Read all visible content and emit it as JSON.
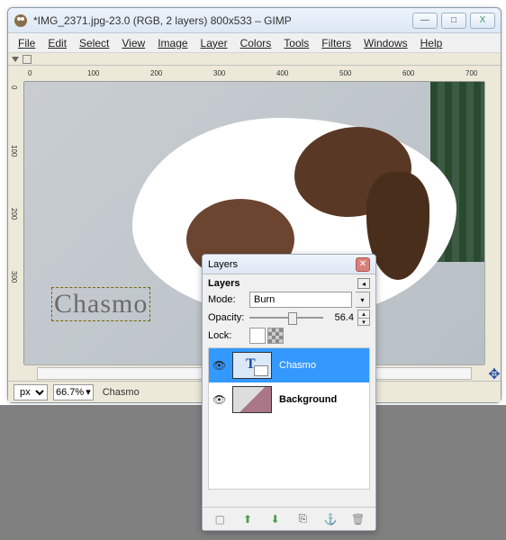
{
  "window": {
    "title": "*IMG_2371.jpg-23.0 (RGB, 2 layers) 800x533 – GIMP",
    "minimize": "—",
    "maximize": "□",
    "close": "X"
  },
  "menu": {
    "file": "File",
    "edit": "Edit",
    "select": "Select",
    "view": "View",
    "image": "Image",
    "layer": "Layer",
    "colors": "Colors",
    "tools": "Tools",
    "filters": "Filters",
    "windows": "Windows",
    "help": "Help"
  },
  "ruler_h": [
    "0",
    "100",
    "200",
    "300",
    "400",
    "500",
    "600",
    "700"
  ],
  "ruler_v": [
    "0",
    "100",
    "200",
    "300"
  ],
  "watermark_text": "Chasmo",
  "status": {
    "unit": "px",
    "zoom": "66.7%",
    "text": "Chasmo"
  },
  "layers_panel": {
    "title": "Layers",
    "section": "Layers",
    "mode_label": "Mode:",
    "mode_value": "Burn",
    "opacity_label": "Opacity:",
    "opacity_value": "56.4",
    "lock_label": "Lock:",
    "layers": [
      {
        "name": "Chasmo",
        "selected": true,
        "type": "text"
      },
      {
        "name": "Background",
        "selected": false,
        "type": "bg"
      }
    ],
    "footer_icons": {
      "new": "□",
      "up": "⬆",
      "down": "⬇",
      "duplicate": "⎘",
      "anchor": "⚓",
      "delete": "🗑"
    }
  }
}
